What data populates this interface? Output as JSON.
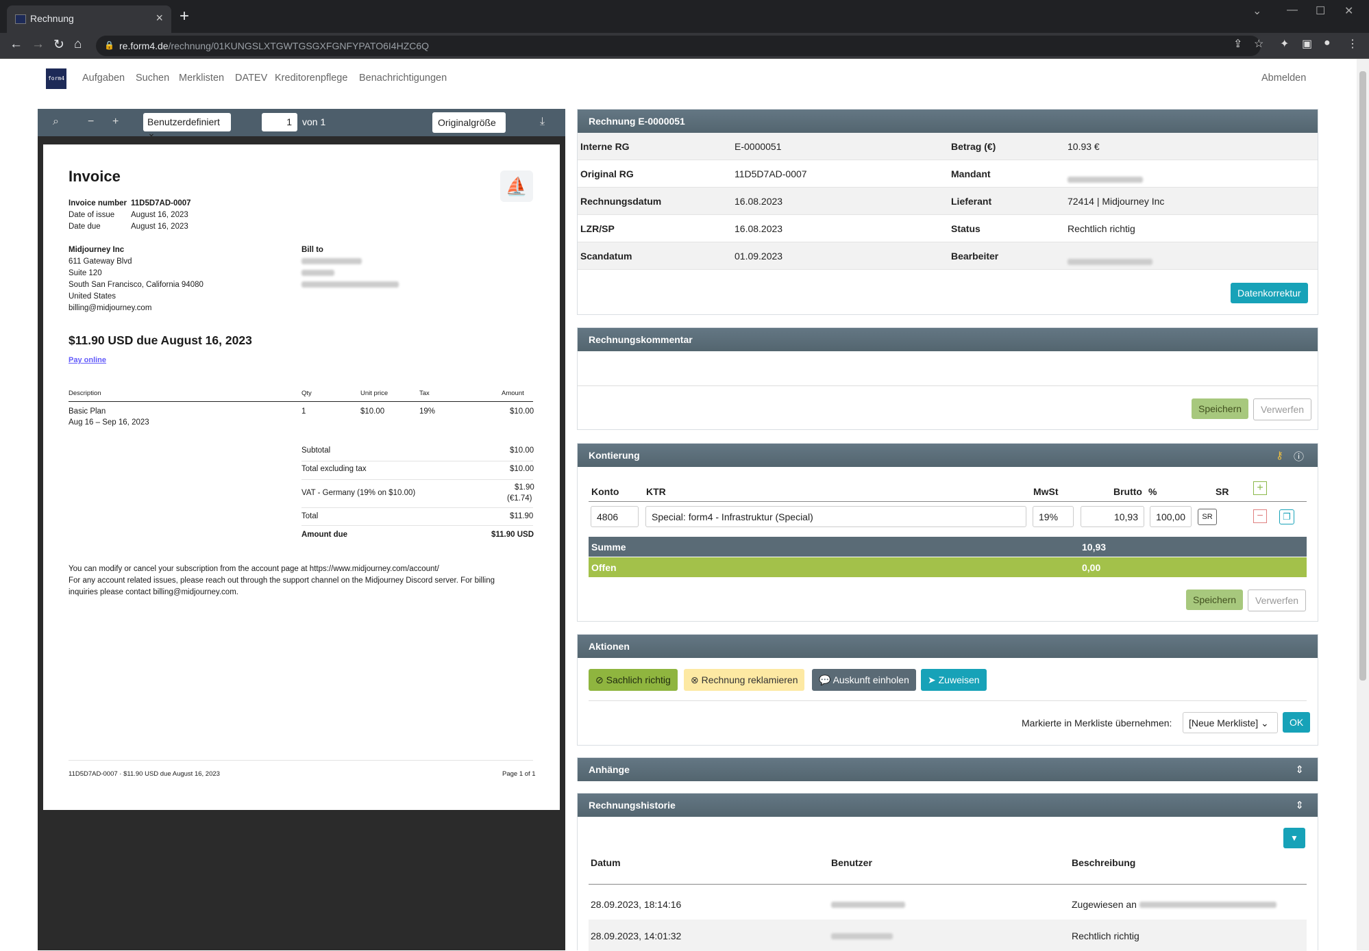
{
  "browser": {
    "tab_title": "Rechnung",
    "url_host": "re.form4.de",
    "url_path": "/rechnung/01KUNGSLXTGWTGSGXFGNFYPATO6I4HZC6Q"
  },
  "nav": {
    "logo": "form4",
    "items": [
      "Aufgaben",
      "Suchen",
      "Merklisten",
      "DATEV",
      "Kreditorenpflege",
      "Benachrichtigungen"
    ],
    "logout": "Abmelden"
  },
  "viewer": {
    "zoom_mode": "Benutzerdefiniert",
    "page": "1",
    "of": "von 1",
    "original_size": "Originalgröße"
  },
  "pdf": {
    "title": "Invoice",
    "meta": [
      {
        "k": "Invoice number",
        "v": "11D5D7AD-0007"
      },
      {
        "k": "Date of issue",
        "v": "August 16, 2023"
      },
      {
        "k": "Date due",
        "v": "August 16, 2023"
      }
    ],
    "from": [
      "Midjourney Inc",
      "611 Gateway Blvd",
      "Suite 120",
      "South San Francisco, California 94080",
      "United States",
      "billing@midjourney.com"
    ],
    "bill_to": "Bill to",
    "due_line": "$11.90 USD due August 16, 2023",
    "pay_online": "Pay online",
    "cols": {
      "desc": "Description",
      "qty": "Qty",
      "unit": "Unit price",
      "tax": "Tax",
      "amount": "Amount"
    },
    "item": {
      "desc": "Basic Plan",
      "period": "Aug 16 – Sep 16, 2023",
      "qty": "1",
      "unit": "$10.00",
      "tax": "19%",
      "amount": "$10.00"
    },
    "totals": [
      {
        "k": "Subtotal",
        "v": "$10.00"
      },
      {
        "k": "Total excluding tax",
        "v": "$10.00"
      },
      {
        "k": "VAT - Germany (19% on $10.00)",
        "v": "$1.90",
        "v2": "(€1.74)"
      },
      {
        "k": "Total",
        "v": "$11.90"
      },
      {
        "k": "Amount due",
        "v": "$11.90 USD"
      }
    ],
    "notes": [
      "You can modify or cancel your subscription from the account page at https://www.midjourney.com/account/",
      "For any account related issues, please reach out through the support channel on the Midjourney Discord server. For billing",
      "inquiries please contact billing@midjourney.com."
    ],
    "footer_left": "11D5D7AD-0007 · $11.90 USD due August 16, 2023",
    "footer_right": "Page 1 of 1"
  },
  "invoice": {
    "header": "Rechnung E-0000051",
    "rows": [
      {
        "l1": "Interne RG",
        "v1": "E-0000051",
        "l2": "Betrag (€)",
        "v2": "10.93 €"
      },
      {
        "l1": "Original RG",
        "v1": "11D5D7AD-0007",
        "l2": "Mandant",
        "v2": ""
      },
      {
        "l1": "Rechnungsdatum",
        "v1": "16.08.2023",
        "l2": "Lieferant",
        "v2": "72414 | Midjourney Inc"
      },
      {
        "l1": "LZR/SP",
        "v1": "16.08.2023",
        "l2": "Status",
        "v2": "Rechtlich richtig"
      },
      {
        "l1": "Scandatum",
        "v1": "01.09.2023",
        "l2": "Bearbeiter",
        "v2": ""
      }
    ],
    "correction": "Datenkorrektur"
  },
  "comment": {
    "header": "Rechnungskommentar",
    "save": "Speichern",
    "discard": "Verwerfen"
  },
  "kontierung": {
    "header": "Kontierung",
    "cols": {
      "konto": "Konto",
      "ktr": "KTR",
      "mwst": "MwSt",
      "brutto": "Brutto",
      "pct": "%",
      "sr": "SR"
    },
    "row": {
      "konto": "4806",
      "ktr": "Special: form4 - Infrastruktur (Special)",
      "mwst": "19%",
      "brutto": "10,93",
      "pct": "100,00",
      "sr": "SR"
    },
    "summe_label": "Summe",
    "summe": "10,93",
    "offen_label": "Offen",
    "offen": "0,00",
    "save": "Speichern",
    "discard": "Verwerfen"
  },
  "actions": {
    "header": "Aktionen",
    "sachlich": "Sachlich richtig",
    "reklamieren": "Rechnung reklamieren",
    "auskunft": "Auskunft einholen",
    "zuweisen": "Zuweisen",
    "merkliste_label": "Markierte in Merkliste übernehmen:",
    "merkliste_value": "[Neue Merkliste]",
    "ok": "OK"
  },
  "attachments": {
    "header": "Anhänge"
  },
  "history": {
    "header": "Rechnungshistorie",
    "cols": {
      "date": "Datum",
      "user": "Benutzer",
      "desc": "Beschreibung"
    },
    "rows": [
      {
        "date": "28.09.2023, 18:14:16",
        "desc": "Zugewiesen an"
      },
      {
        "date": "28.09.2023, 14:01:32",
        "desc": "Rechtlich richtig"
      }
    ]
  },
  "colors": {
    "accent": "#17a2b8",
    "header": "#5c6f7b",
    "success": "#a3c14a",
    "warning": "#fde9a3",
    "dark": "#5a6a75"
  }
}
